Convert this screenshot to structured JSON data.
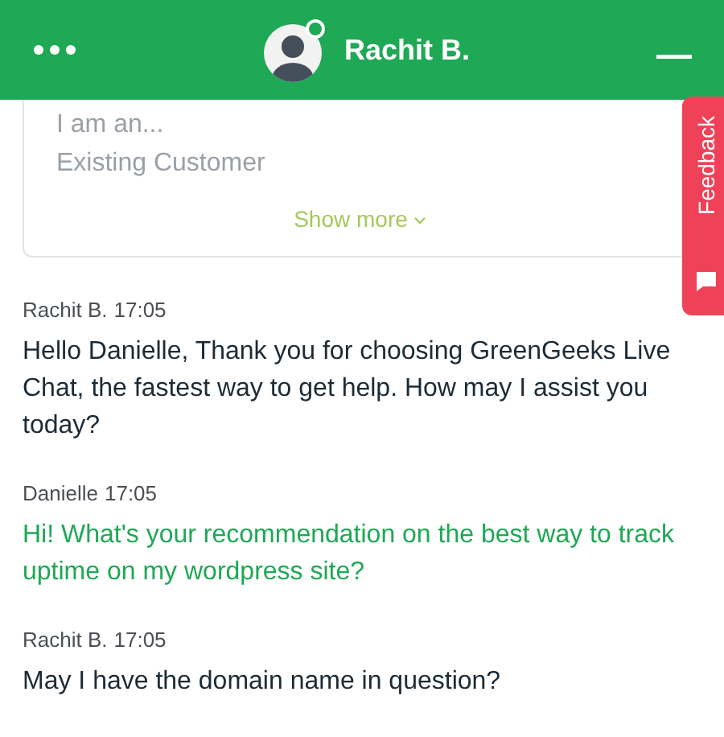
{
  "header": {
    "agent_name": "Rachit B.",
    "agent_online": true
  },
  "intro_card": {
    "label": "I am an...",
    "value": "Existing Customer",
    "show_more": "Show more"
  },
  "feedback_tab": {
    "label": "Feedback"
  },
  "messages": [
    {
      "kind": "agent",
      "author": "Rachit B.",
      "time": "17:05",
      "text": "Hello Danielle, Thank you for choosing GreenGeeks Live Chat, the fastest way to get help. How may I assist you today?"
    },
    {
      "kind": "visitor",
      "author": "Danielle",
      "time": "17:05",
      "text": "Hi! What's your recommendation on the best way to track uptime on my wordpress site?"
    },
    {
      "kind": "agent",
      "author": "Rachit B.",
      "time": "17:05",
      "text": "May I have the domain name in question?"
    }
  ]
}
